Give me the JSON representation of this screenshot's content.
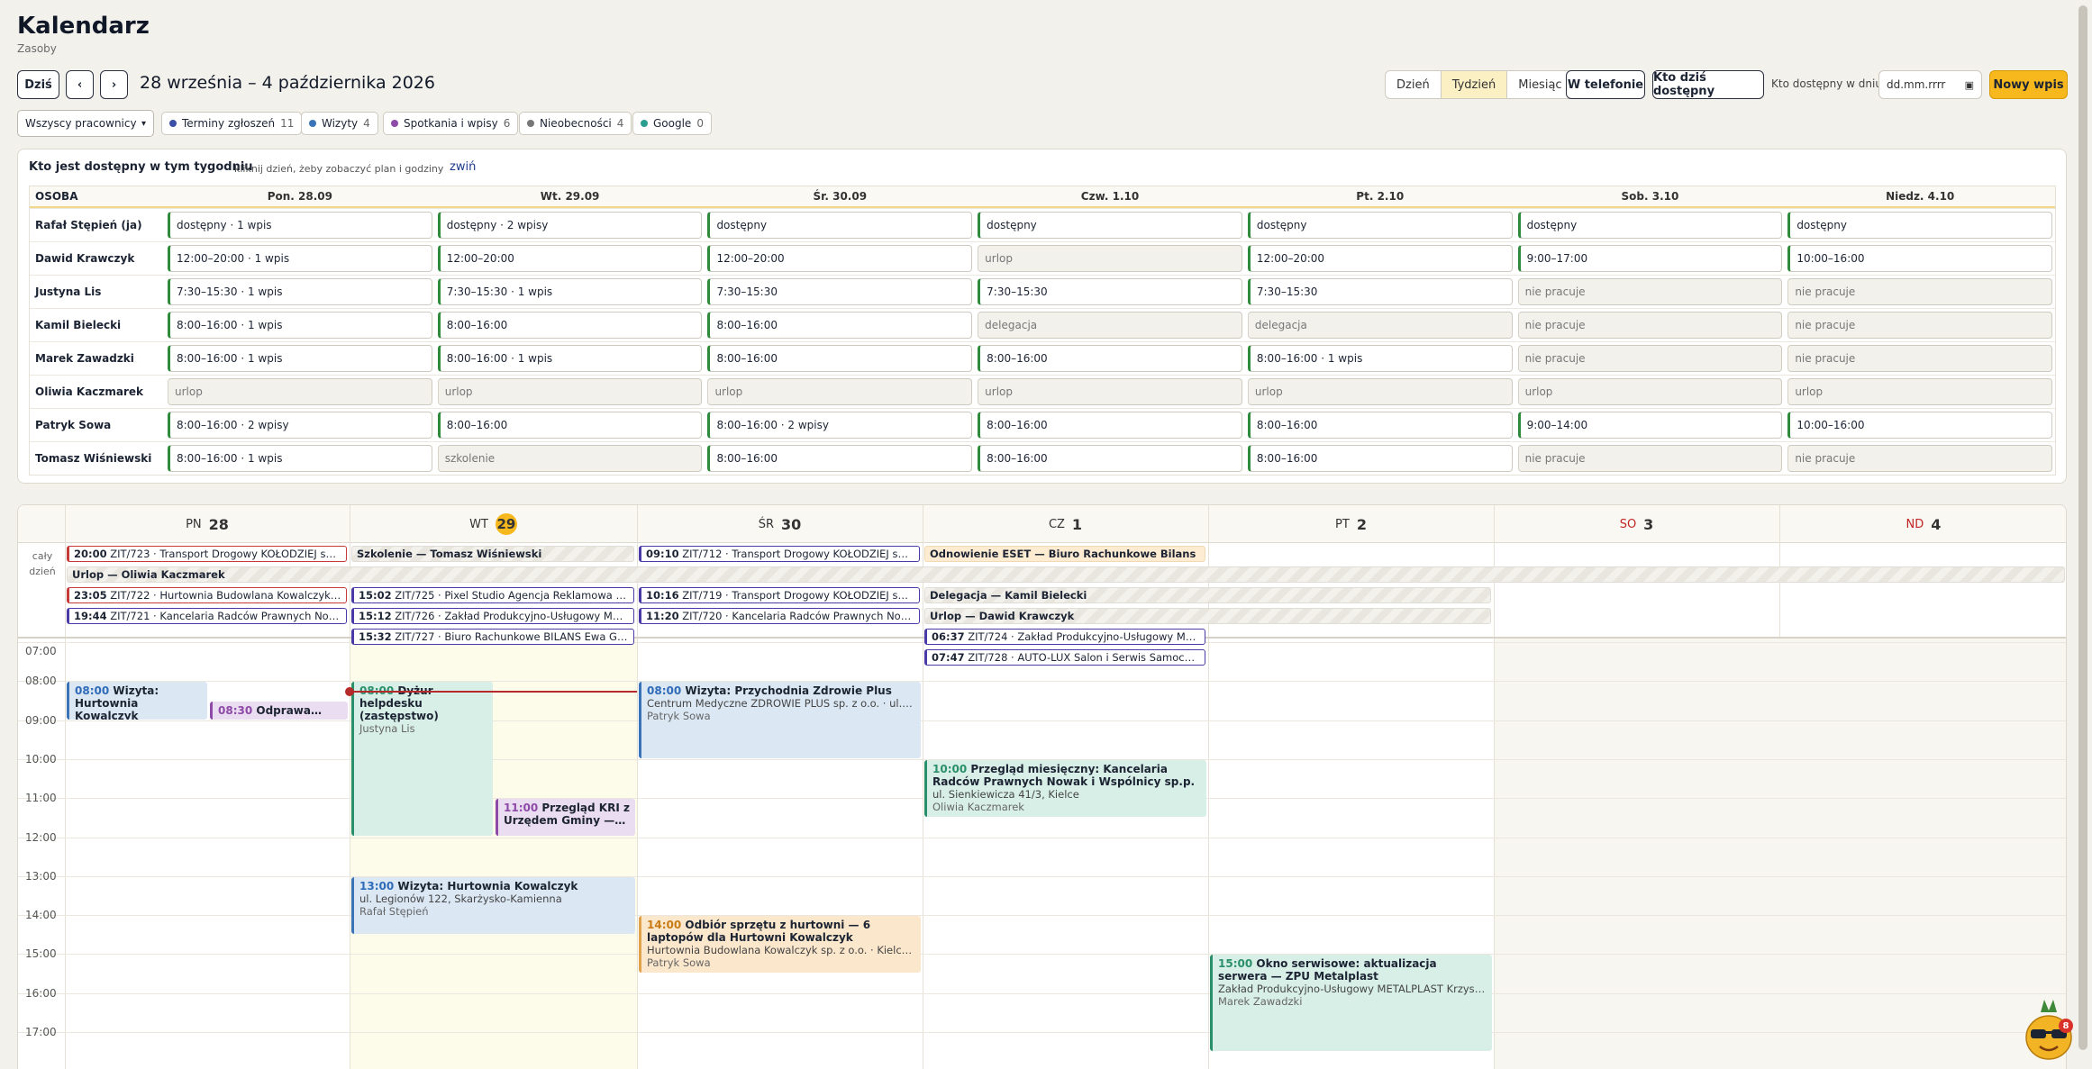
{
  "app": {
    "title": "Kalendarz",
    "subtitle": "Zasoby"
  },
  "toolbar": {
    "today": "Dziś",
    "prev": "‹",
    "next": "›",
    "range": "28 września – 4 października 2026",
    "views": [
      "Dzień",
      "Tydzień",
      "Miesiąc"
    ],
    "active_view": "Tydzień",
    "phone": "W telefonie",
    "who_today": "Kto dziś dostępny",
    "who_on_day_label": "Kto dostępny w dniu",
    "date_placeholder": "dd.mm.rrrr",
    "new_entry": "Nowy wpis"
  },
  "filters": {
    "employee_select": "Wszyscy pracownicy",
    "chips": [
      {
        "label": "Terminy zgłoszeń",
        "count": "11",
        "color": "#3b4ea8"
      },
      {
        "label": "Wizyty",
        "count": "4",
        "color": "#3b73b9"
      },
      {
        "label": "Spotkania i wpisy",
        "count": "6",
        "color": "#8d4aa7"
      },
      {
        "label": "Nieobecności",
        "count": "4",
        "color": "#777777"
      },
      {
        "label": "Google",
        "count": "0",
        "color": "#2a9d8f"
      }
    ]
  },
  "availability": {
    "title": "Kto jest dostępny w tym tygodniu",
    "hint": "kliknij dzień, żeby zobaczyć plan i godziny",
    "collapse": "zwiń",
    "person_header": "OSOBA",
    "days": [
      "Pon. 28.09",
      "Wt. 29.09",
      "Śr. 30.09",
      "Czw. 1.10",
      "Pt. 2.10",
      "Sob. 3.10",
      "Niedz. 4.10"
    ],
    "rows": [
      {
        "name": "Rafał Stępień (ja)",
        "cells": [
          [
            "dostępny · 1 wpis",
            1
          ],
          [
            "dostępny · 2 wpisy",
            1
          ],
          [
            "dostępny",
            1
          ],
          [
            "dostępny",
            1
          ],
          [
            "dostępny",
            1
          ],
          [
            "dostępny",
            1
          ],
          [
            "dostępny",
            1
          ]
        ]
      },
      {
        "name": "Dawid Krawczyk",
        "cells": [
          [
            "12:00–20:00 · 1 wpis",
            1
          ],
          [
            "12:00–20:00",
            1
          ],
          [
            "12:00–20:00",
            1
          ],
          [
            "urlop",
            0
          ],
          [
            "12:00–20:00",
            1
          ],
          [
            "9:00–17:00",
            1
          ],
          [
            "10:00–16:00",
            1
          ]
        ]
      },
      {
        "name": "Justyna Lis",
        "cells": [
          [
            "7:30–15:30 · 1 wpis",
            1
          ],
          [
            "7:30–15:30 · 1 wpis",
            1
          ],
          [
            "7:30–15:30",
            1
          ],
          [
            "7:30–15:30",
            1
          ],
          [
            "7:30–15:30",
            1
          ],
          [
            "nie pracuje",
            0
          ],
          [
            "nie pracuje",
            0
          ]
        ]
      },
      {
        "name": "Kamil Bielecki",
        "cells": [
          [
            "8:00–16:00 · 1 wpis",
            1
          ],
          [
            "8:00–16:00",
            1
          ],
          [
            "8:00–16:00",
            1
          ],
          [
            "delegacja",
            0
          ],
          [
            "delegacja",
            0
          ],
          [
            "nie pracuje",
            0
          ],
          [
            "nie pracuje",
            0
          ]
        ]
      },
      {
        "name": "Marek Zawadzki",
        "cells": [
          [
            "8:00–16:00 · 1 wpis",
            1
          ],
          [
            "8:00–16:00 · 1 wpis",
            1
          ],
          [
            "8:00–16:00",
            1
          ],
          [
            "8:00–16:00",
            1
          ],
          [
            "8:00–16:00 · 1 wpis",
            1
          ],
          [
            "nie pracuje",
            0
          ],
          [
            "nie pracuje",
            0
          ]
        ]
      },
      {
        "name": "Oliwia Kaczmarek",
        "cells": [
          [
            "urlop",
            0
          ],
          [
            "urlop",
            0
          ],
          [
            "urlop",
            0
          ],
          [
            "urlop",
            0
          ],
          [
            "urlop",
            0
          ],
          [
            "urlop",
            0
          ],
          [
            "urlop",
            0
          ]
        ]
      },
      {
        "name": "Patryk Sowa",
        "cells": [
          [
            "8:00–16:00 · 2 wpisy",
            1
          ],
          [
            "8:00–16:00",
            1
          ],
          [
            "8:00–16:00 · 2 wpisy",
            1
          ],
          [
            "8:00–16:00",
            1
          ],
          [
            "8:00–16:00",
            1
          ],
          [
            "9:00–14:00",
            1
          ],
          [
            "10:00–16:00",
            1
          ]
        ]
      },
      {
        "name": "Tomasz Wiśniewski",
        "cells": [
          [
            "8:00–16:00 · 1 wpis",
            1
          ],
          [
            "szkolenie",
            0
          ],
          [
            "8:00–16:00",
            1
          ],
          [
            "8:00–16:00",
            1
          ],
          [
            "8:00–16:00",
            1
          ],
          [
            "nie pracuje",
            0
          ],
          [
            "nie pracuje",
            0
          ]
        ]
      }
    ]
  },
  "calendar": {
    "days": [
      {
        "abbr": "PN",
        "num": "28"
      },
      {
        "abbr": "WT",
        "num": "29",
        "today": true
      },
      {
        "abbr": "ŚR",
        "num": "30"
      },
      {
        "abbr": "CZ",
        "num": "1"
      },
      {
        "abbr": "PT",
        "num": "2"
      },
      {
        "abbr": "SO",
        "num": "3",
        "weekend": true
      },
      {
        "abbr": "ND",
        "num": "4",
        "weekend": true
      }
    ],
    "allday_label": "cały dzień",
    "hours": [
      "07:00",
      "08:00",
      "09:00",
      "10:00",
      "11:00",
      "12:00",
      "13:00",
      "14:00",
      "15:00",
      "16:00",
      "17:00"
    ],
    "allday": [
      {
        "time": "20:00",
        "text": "ZIT/723 · Transport Drogowy KOŁODZIEJ sp.…",
        "style": "red"
      },
      {
        "time": "",
        "text": "Szkolenie — Tomasz Wiśniewski",
        "style": "gray"
      },
      {
        "time": "09:10",
        "text": "ZIT/712 · Transport Drogowy KOŁODZIEJ sp. …",
        "style": "navy"
      },
      {
        "time": "",
        "text": "Odnowienie ESET — Biuro Rachunkowe Bilans",
        "style": "peach"
      },
      {
        "time": "",
        "text": "Urlop — Oliwia Kaczmarek",
        "style": "gray"
      },
      {
        "time": "23:05",
        "text": "ZIT/722 · Hurtownia Budowlana Kowalczyk s…",
        "style": "red"
      },
      {
        "time": "15:02",
        "text": "ZIT/725 · Pixel Studio Agencja Reklamowa M…",
        "style": "navy"
      },
      {
        "time": "10:16",
        "text": "ZIT/719 · Transport Drogowy KOŁODZIEJ sp. …",
        "style": "navy"
      },
      {
        "time": "",
        "text": "Delegacja — Kamil Bielecki",
        "style": "gray"
      },
      {
        "time": "19:44",
        "text": "ZIT/721 · Kancelaria Radców Prawnych Now…",
        "style": "navy"
      },
      {
        "time": "15:12",
        "text": "ZIT/726 · Zakład Produkcyjno-Usługowy ME…",
        "style": "navy"
      },
      {
        "time": "11:20",
        "text": "ZIT/720 · Kancelaria Radców Prawnych Now…",
        "style": "navy"
      },
      {
        "time": "",
        "text": "Urlop — Dawid Krawczyk",
        "style": "gray"
      },
      {
        "time": "15:32",
        "text": "ZIT/727 · Biuro Rachunkowe BILANS Ewa Gr…",
        "style": "navy"
      },
      {
        "time": "06:37",
        "text": "ZIT/724 · Zakład Produkcyjno-Usługowy ME…",
        "style": "navy"
      },
      {
        "time": "07:47",
        "text": "ZIT/728 · AUTO-LUX Salon i Serwis Samocho…",
        "style": "navy"
      }
    ],
    "events": [
      {
        "time": "08:00",
        "title": "Wizyta: Hurtownia Kowalczyk",
        "sub": "",
        "person": "",
        "style": "blue"
      },
      {
        "time": "08:30",
        "title": "Odprawa…",
        "sub": "",
        "person": "",
        "style": "purple"
      },
      {
        "time": "08:00",
        "title": "Dyżur helpdesku (zastępstwo)",
        "sub": "",
        "person": "Justyna Lis",
        "style": "teal"
      },
      {
        "time": "11:00",
        "title": "Przegląd KRI z Urzędem Gminy —…",
        "sub": "",
        "person": "",
        "style": "purple"
      },
      {
        "time": "13:00",
        "title": "Wizyta: Hurtownia Kowalczyk",
        "sub": "ul. Legionów 122, Skarżysko-Kamienna",
        "person": "Rafał Stępień",
        "style": "blue"
      },
      {
        "time": "08:00",
        "title": "Wizyta: Przychodnia Zdrowie Plus",
        "sub": "Centrum Medyczne ZDROWIE PLUS sp. z o.o. · ul. Sie…",
        "person": "Patryk Sowa",
        "style": "blue"
      },
      {
        "time": "14:00",
        "title": "Odbiór sprzętu z hurtowni — 6 laptopów dla Hurtowni Kowalczyk",
        "sub": "Hurtownia Budowlana Kowalczyk sp. z o.o. · Kielce, u…",
        "person": "Patryk Sowa",
        "style": "peach"
      },
      {
        "time": "10:00",
        "title": "Przegląd miesięczny: Kancelaria Radców Prawnych Nowak i Wspólnicy sp.p.",
        "sub": "ul. Sienkiewicza 41/3, Kielce",
        "person": "Oliwia Kaczmarek",
        "style": "teal"
      },
      {
        "time": "15:00",
        "title": "Okno serwisowe: aktualizacja serwera — ZPU Metalplast",
        "sub": "Zakład Produkcyjno-Usługowy METALPLAST Krzysz…",
        "person": "Marek Zawadzki",
        "style": "teal"
      }
    ]
  },
  "assistant": {
    "badge": "8"
  }
}
